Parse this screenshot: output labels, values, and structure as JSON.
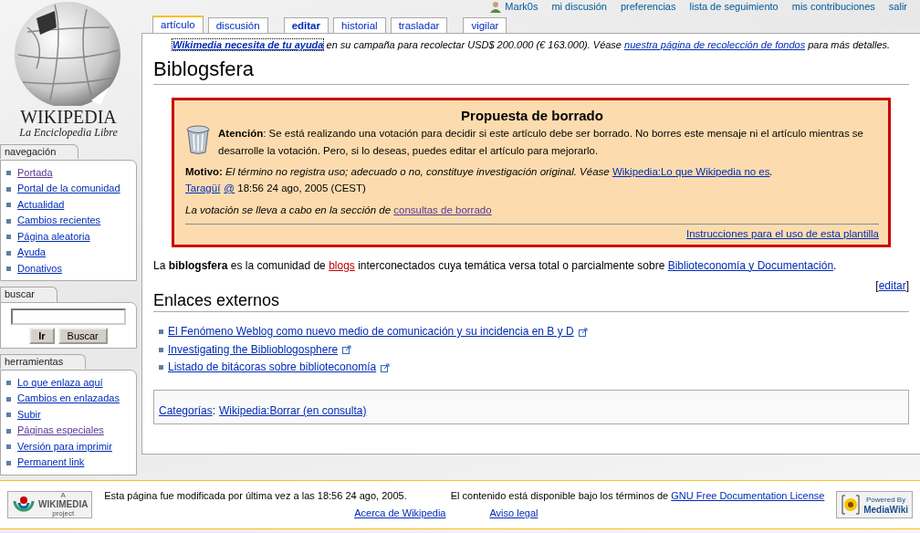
{
  "user_bar": [
    {
      "kind": "user",
      "label": "Mark0s"
    },
    {
      "kind": "link",
      "label": "mi discusión"
    },
    {
      "kind": "link",
      "label": "preferencias"
    },
    {
      "kind": "link",
      "label": "lista de seguimiento"
    },
    {
      "kind": "link",
      "label": "mis contribuciones"
    },
    {
      "kind": "link",
      "label": "salir"
    }
  ],
  "logo": {
    "wordmark": "WIKIPEDIA",
    "tagline": "La Enciclopedia Libre"
  },
  "tab_groups": [
    [
      {
        "label": "artículo",
        "selected": true,
        "strong": false
      },
      {
        "label": "discusión",
        "selected": false,
        "strong": false
      }
    ],
    [
      {
        "label": "editar",
        "selected": false,
        "strong": true
      },
      {
        "label": "historial",
        "selected": false,
        "strong": false
      },
      {
        "label": "trasladar",
        "selected": false,
        "strong": false
      }
    ],
    [
      {
        "label": "vigilar",
        "selected": false,
        "strong": false
      }
    ]
  ],
  "sitenotice": [
    {
      "t": "Wikimedia necesita de tu ayuda",
      "kind": "strong-link"
    },
    {
      "t": " en su campaña para recolectar USD$ 200.000 (€ 163.000). Véase ",
      "kind": "italic"
    },
    {
      "t": "nuestra página de recolección de fondos",
      "kind": "link"
    },
    {
      "t": " para más detalles.",
      "kind": "italic"
    }
  ],
  "title": "Biblogsfera",
  "notice": {
    "title": "Propuesta de borrado",
    "attention": [
      {
        "t": "Atención",
        "kind": "bold"
      },
      {
        "t": ": Se está realizando una votación para decidir si este artículo debe ser borrado. No borres este mensaje ni el artículo mientras se desarrolle la votación. Pero, si lo deseas, puedes editar el artículo para mejorarlo.",
        "kind": "text"
      }
    ],
    "reason": [
      {
        "t": "Motivo:",
        "kind": "bold"
      },
      {
        "t": " El término no registra uso; adecuado o no, constituye investigación original. Véase ",
        "kind": "italic"
      },
      {
        "t": "Wikipedia:Lo que Wikipedia no es",
        "kind": "link"
      },
      {
        "t": ".",
        "kind": "italic"
      }
    ],
    "signature": [
      {
        "t": "Taragüí",
        "kind": "link"
      },
      {
        "t": "@",
        "kind": "link"
      },
      {
        "t": " 18:56 24 ago, 2005 (CEST)",
        "kind": "text"
      }
    ],
    "vote": [
      {
        "t": "La votación se lleva a cabo en la sección de ",
        "kind": "italic"
      },
      {
        "t": "consultas de borrado",
        "kind": "visited"
      }
    ],
    "instructions": "Instrucciones para el uso de esta plantilla"
  },
  "paragraph": [
    {
      "t": "La ",
      "kind": "text"
    },
    {
      "t": "biblogsfera",
      "kind": "bold"
    },
    {
      "t": " es la comunidad de ",
      "kind": "text"
    },
    {
      "t": "blogs",
      "kind": "new"
    },
    {
      "t": " interconectados cuya temática versa total o parcialmente sobre ",
      "kind": "text"
    },
    {
      "t": "Biblioteconomía y Documentación",
      "kind": "link"
    },
    {
      "t": ".",
      "kind": "text"
    }
  ],
  "section": {
    "edit": [
      {
        "t": "[",
        "kind": "text"
      },
      {
        "t": "editar",
        "kind": "link"
      },
      {
        "t": "]",
        "kind": "text"
      }
    ],
    "heading": "Enlaces externos",
    "links": [
      "El Fenómeno Weblog como nuevo medio de comunicación y su incidencia en B y D",
      "Investigating the Biblioblogosphere",
      "Listado de bitácoras sobre biblioteconomía"
    ]
  },
  "categories": {
    "label": "Categorías",
    "separator": ":",
    "items": [
      "Wikipedia:Borrar (en consulta)"
    ]
  },
  "sidebar": [
    {
      "title": "navegación",
      "kind": "links",
      "items": [
        {
          "label": "Portada",
          "visited": true
        },
        {
          "label": "Portal de la comunidad",
          "visited": false
        },
        {
          "label": "Actualidad",
          "visited": false
        },
        {
          "label": "Cambios recientes",
          "visited": false
        },
        {
          "label": "Página aleatoria",
          "visited": false
        },
        {
          "label": "Ayuda",
          "visited": false
        },
        {
          "label": "Donativos",
          "visited": false
        }
      ]
    },
    {
      "title": "buscar",
      "kind": "search",
      "buttons": [
        {
          "label": "Ir",
          "strong": true
        },
        {
          "label": "Buscar",
          "strong": false
        }
      ]
    },
    {
      "title": "herramientas",
      "kind": "links",
      "items": [
        {
          "label": "Lo que enlaza aquí",
          "visited": false
        },
        {
          "label": "Cambios en enlazadas",
          "visited": false
        },
        {
          "label": "Subir",
          "visited": false
        },
        {
          "label": "Páginas especiales",
          "visited": true
        },
        {
          "label": "Versión para imprimir",
          "visited": false
        },
        {
          "label": "Permanent link",
          "visited": false
        }
      ]
    }
  ],
  "footer": {
    "left_badge": [
      "A",
      "WIKIMEDIA",
      "project"
    ],
    "lastmod": "Esta página fue modificada por última vez a las 18:56 24 ago, 2005.",
    "license": [
      {
        "t": "El contenido está disponible bajo los términos de ",
        "kind": "text"
      },
      {
        "t": "GNU Free Documentation License",
        "kind": "link"
      }
    ],
    "links": [
      "Acerca de Wikipedia",
      "Aviso legal"
    ],
    "right_badge": [
      "Powered By",
      "MediaWiki"
    ]
  }
}
